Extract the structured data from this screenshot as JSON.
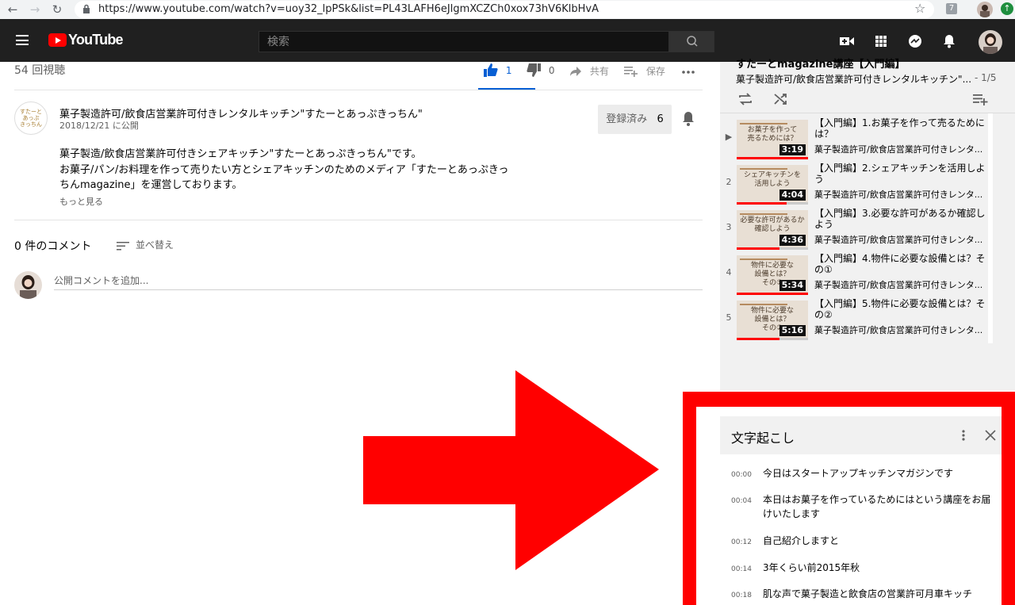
{
  "browser": {
    "url": "https://www.youtube.com/watch?v=uoy32_lpPSk&list=PL43LAFH6eJlgmXCZCh0xox73hV6KlbHvA",
    "ext_label": "7"
  },
  "masthead": {
    "logo_text": "YouTube",
    "search_placeholder": "検索"
  },
  "video": {
    "views": "54 回視聴",
    "likes": "1",
    "dislikes": "0",
    "share_label": "共有",
    "save_label": "保存"
  },
  "channel": {
    "name": "菓子製造許可/飲食店営業許可付きレンタルキッチン\"すたーとあっぷきっちん\"",
    "published": "2018/12/21 に公開",
    "subscribe_label": "登録済み",
    "subscriber_count": "6",
    "avatar_lines": [
      "すたーと",
      "あっぷ",
      "きっちん"
    ]
  },
  "description": {
    "lines": [
      "菓子製造/飲食店営業許可付きシェアキッチン\"すたーとあっぷきっちん\"です。",
      "お菓子/パン/お料理を作って売りたい方とシェアキッチンのためのメディア「すたーとあっぷきっ",
      "ちんmagazine」を運営しております。"
    ],
    "show_more": "もっと見る"
  },
  "comments": {
    "count_label": "0 件のコメント",
    "sort_label": "並べ替え",
    "input_placeholder": "公開コメントを追加..."
  },
  "playlist": {
    "title_partial": "すたーとmagazine講座【入門編】",
    "channel": "菓子製造許可/飲食店営業許可付きレンタルキッチン\"...",
    "index": "- 1/5",
    "items": [
      {
        "num": "▶",
        "title": "【入門編】1.お菓子を作って売るためには？",
        "channel": "菓子製造許可/飲食店営業許可付きレンタ...",
        "duration": "3:19",
        "thumb_text": "お菓子を作って\n売るためには？",
        "progress": 1.0
      },
      {
        "num": "2",
        "title": "【入門編】2.シェアキッチンを活用しよう",
        "channel": "菓子製造許可/飲食店営業許可付きレンタ...",
        "duration": "4:04",
        "thumb_text": "シェアキッチンを\n活用しよう",
        "progress": 0.7
      },
      {
        "num": "3",
        "title": "【入門編】3.必要な許可があるか確認しよう",
        "channel": "菓子製造許可/飲食店営業許可付きレンタ...",
        "duration": "4:36",
        "thumb_text": "必要な許可があるか\n確認しよう",
        "progress": 0.6
      },
      {
        "num": "4",
        "title": "【入門編】4.物件に必要な設備とは？その①",
        "channel": "菓子製造許可/飲食店営業許可付きレンタ...",
        "duration": "5:34",
        "thumb_text": "物件に必要な\n設備とは？\nその①",
        "progress": 1.0
      },
      {
        "num": "5",
        "title": "【入門編】5.物件に必要な設備とは？その②",
        "channel": "菓子製造許可/飲食店営業許可付きレンタ...",
        "duration": "5:16",
        "thumb_text": "物件に必要な\n設備とは？\nその②",
        "progress": 0.6
      }
    ]
  },
  "transcript": {
    "title": "文字起こし",
    "entries": [
      {
        "time": "00:00",
        "text": "今日はスタートアップキッチンマガジンです"
      },
      {
        "time": "00:04",
        "text": "本日はお菓子を作っているためにはという講座をお届けいたします"
      },
      {
        "time": "00:12",
        "text": "自己紹介しますと"
      },
      {
        "time": "00:14",
        "text": "3年くらい前2015年秋"
      },
      {
        "time": "00:18",
        "text": "肌な声で菓子製造と飲食店の営業許可月車キッチ"
      }
    ]
  },
  "colors": {
    "youtube_red": "#ff0000",
    "like_blue": "#065fd4",
    "masthead_bg": "#202020",
    "annotation_red": "#ff0000"
  },
  "icons": [
    "back-icon",
    "forward-icon",
    "reload-icon",
    "lock-icon",
    "star-icon",
    "menu-icon",
    "search-icon",
    "create-video-icon",
    "apps-icon",
    "messages-icon",
    "notifications-icon",
    "thumbs-up-icon",
    "thumbs-down-icon",
    "share-icon",
    "add-to-playlist-icon",
    "more-icon",
    "bell-icon",
    "sort-icon",
    "loop-icon",
    "shuffle-icon",
    "save-playlist-icon",
    "close-icon"
  ]
}
